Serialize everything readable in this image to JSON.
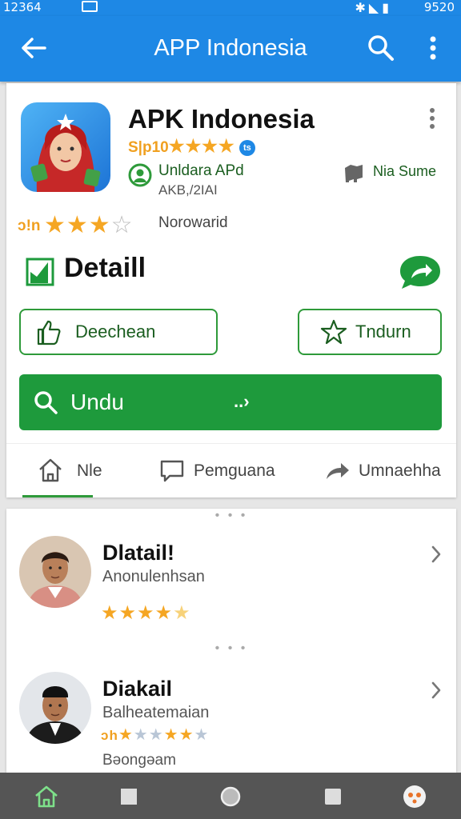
{
  "status_bar": {
    "time": "12364",
    "battery": "9520"
  },
  "app_bar": {
    "title": "APP Indonesia"
  },
  "app": {
    "name": "APK Indonesia",
    "rating_prefix": "S|p10",
    "rating_stars": "★★★★",
    "badge": "ts",
    "developer": "Unldara APd",
    "developer_sub": "AKB,/2IAI",
    "extra_label": "Nia Sume"
  },
  "rating": {
    "prefix": "ɔ!n",
    "stars_on": "★★★",
    "stars_off": "☆",
    "label": "Norowarid"
  },
  "detail": {
    "title": "Detaill",
    "button_left": "Deechean",
    "button_right": "Tndurn",
    "primary_label": "Undu",
    "primary_arrow": "..›"
  },
  "tabs": [
    {
      "label": "Nle"
    },
    {
      "label": "Pemguana"
    },
    {
      "label": "Umnaehha"
    }
  ],
  "list": {
    "separator": "• • •",
    "items": [
      {
        "title": "Dlatail!",
        "subtitle": "Anonulenhsan",
        "stars_on": "★★★★",
        "stars_off": "★"
      },
      {
        "title": "Diakail",
        "subtitle": "Balheatemaian",
        "prefix": "ɔh",
        "stars_on": "★",
        "stars_mid": "★★",
        "stars_on2": "★★",
        "stars_off": "★",
        "extra": "Bəongəam"
      }
    ]
  },
  "colors": {
    "primary": "#1e88e5",
    "accent": "#1e9a3c",
    "star": "#f5a623"
  }
}
